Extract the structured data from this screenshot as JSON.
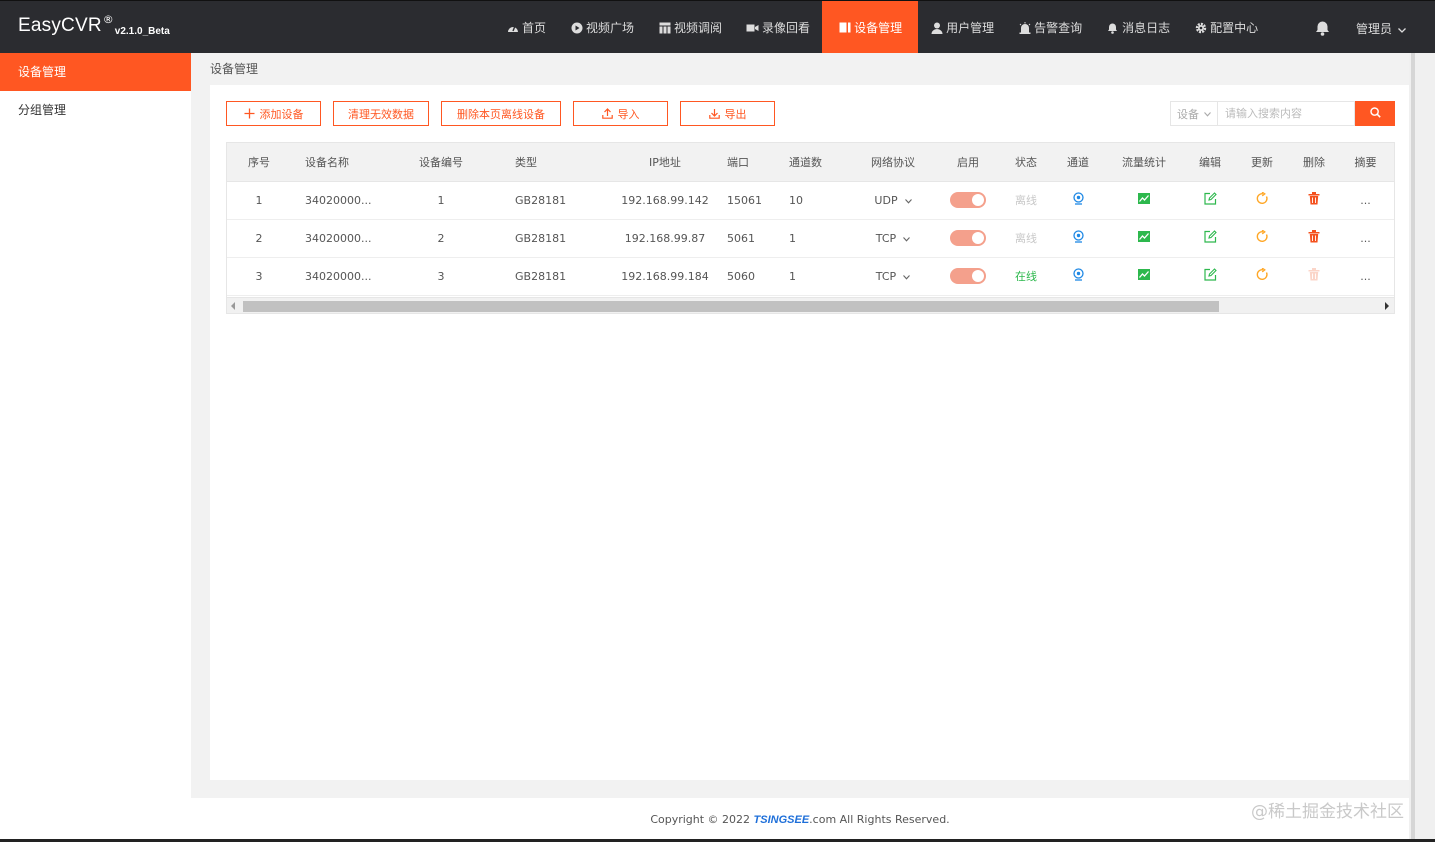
{
  "app": {
    "name": "EasyCVR",
    "reg_mark": "®",
    "version": "v2.1.0_Beta"
  },
  "nav": [
    {
      "label": "首页",
      "icon": "dashboard-icon"
    },
    {
      "label": "视频广场",
      "icon": "play-circle-icon"
    },
    {
      "label": "视频调阅",
      "icon": "grid-icon"
    },
    {
      "label": "录像回看",
      "icon": "video-camera-icon"
    },
    {
      "label": "设备管理",
      "icon": "device-icon",
      "active": true
    },
    {
      "label": "用户管理",
      "icon": "user-icon"
    },
    {
      "label": "告警查询",
      "icon": "alarm-icon"
    },
    {
      "label": "消息日志",
      "icon": "bell-icon"
    },
    {
      "label": "配置中心",
      "icon": "gear-icon"
    }
  ],
  "user": {
    "label": "管理员"
  },
  "sidebar": {
    "items": [
      {
        "label": "设备管理",
        "active": true
      },
      {
        "label": "分组管理"
      }
    ]
  },
  "breadcrumb": "设备管理",
  "toolbar": {
    "add": "添加设备",
    "clear": "清理无效数据",
    "delete_offline": "删除本页离线设备",
    "import": "导入",
    "export": "导出"
  },
  "search": {
    "select_value": "设备",
    "placeholder": "请输入搜索内容"
  },
  "table": {
    "columns": [
      "序号",
      "设备名称",
      "设备编号",
      "类型",
      "IP地址",
      "端口",
      "通道数",
      "网络协议",
      "启用",
      "状态",
      "通道",
      "流量统计",
      "编辑",
      "更新",
      "删除",
      "摘要"
    ],
    "rows": [
      {
        "no": "1",
        "name": "34020000...",
        "code": "1",
        "type": "GB28181",
        "ip": "192.168.99.142",
        "port": "15061",
        "channels": "10",
        "protocol": "UDP",
        "enabled": true,
        "status": "离线",
        "online": false,
        "summary": "..."
      },
      {
        "no": "2",
        "name": "34020000...",
        "code": "2",
        "type": "GB28181",
        "ip": "192.168.99.87",
        "port": "5061",
        "channels": "1",
        "protocol": "TCP",
        "enabled": true,
        "status": "离线",
        "online": false,
        "summary": "..."
      },
      {
        "no": "3",
        "name": "34020000...",
        "code": "3",
        "type": "GB28181",
        "ip": "192.168.99.184",
        "port": "5060",
        "channels": "1",
        "protocol": "TCP",
        "enabled": true,
        "status": "在线",
        "online": true,
        "summary": "..."
      }
    ]
  },
  "footer": {
    "prefix": "Copyright © 2022 ",
    "brand": "TSINGSEE",
    "suffix": ".com All Rights Reserved."
  },
  "watermark": "@稀土掘金技术社区",
  "colors": {
    "accent": "#ff5722",
    "topbar": "#2b2c30",
    "online": "#2db84d",
    "offline": "#c8c8c8",
    "channel_icon": "#1e88e5",
    "edit_icon": "#2db84d",
    "update_icon": "#ffa726",
    "delete_icon": "#f4511e"
  }
}
